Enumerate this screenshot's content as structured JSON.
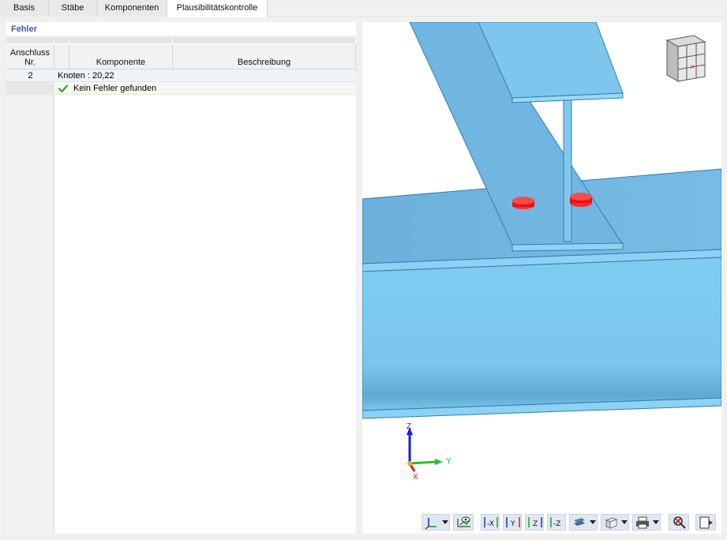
{
  "tabs": [
    {
      "label": "Basis",
      "active": false
    },
    {
      "label": "Stäbe",
      "active": false
    },
    {
      "label": "Komponenten",
      "active": false
    },
    {
      "label": "Plausibilitätskontrolle",
      "active": true
    }
  ],
  "panel": {
    "title": "Fehler",
    "columns": {
      "nr_line1": "Anschluss",
      "nr_line2": "Nr.",
      "komponente": "Komponente",
      "beschreibung": "Beschreibung"
    },
    "rows": [
      {
        "nr": "2",
        "text": "Knoten : 20,22"
      },
      {
        "nr": "",
        "status_icon": "check-icon",
        "text": "Kein Fehler gefunden"
      }
    ]
  },
  "viewport": {
    "axes": {
      "z": "Z",
      "y": "Y",
      "x": "X"
    },
    "colors": {
      "steel": "#7ec8f0",
      "bolt": "#e81c1c",
      "axis_z": "#1a1ae0",
      "axis_y": "#22c422",
      "axis_x": "#e02020"
    },
    "toolbar": [
      {
        "name": "coordinate-system-button",
        "icon": "axes-icon",
        "dropdown": true
      },
      {
        "name": "view-filter-button",
        "icon": "eye-icon",
        "dropdown": false
      },
      {
        "name": "view-minus-x-button",
        "icon": "view-x-icon",
        "label": "-X"
      },
      {
        "name": "view-y-button",
        "icon": "view-y-icon",
        "label": "Y"
      },
      {
        "name": "view-z-button",
        "icon": "view-z-icon",
        "label": "Z"
      },
      {
        "name": "view-minus-z-button",
        "icon": "view-minus-z-icon",
        "label": "-Z"
      },
      {
        "name": "render-mode-button",
        "icon": "render-icon",
        "dropdown": true
      },
      {
        "name": "transparency-button",
        "icon": "box-icon",
        "dropdown": true
      },
      {
        "name": "print-button",
        "icon": "print-icon",
        "dropdown": true
      },
      {
        "name": "reset-view-button",
        "icon": "zoom-reset-icon",
        "dropdown": false
      },
      {
        "name": "export-button",
        "icon": "export-icon",
        "dropdown": false
      }
    ]
  }
}
